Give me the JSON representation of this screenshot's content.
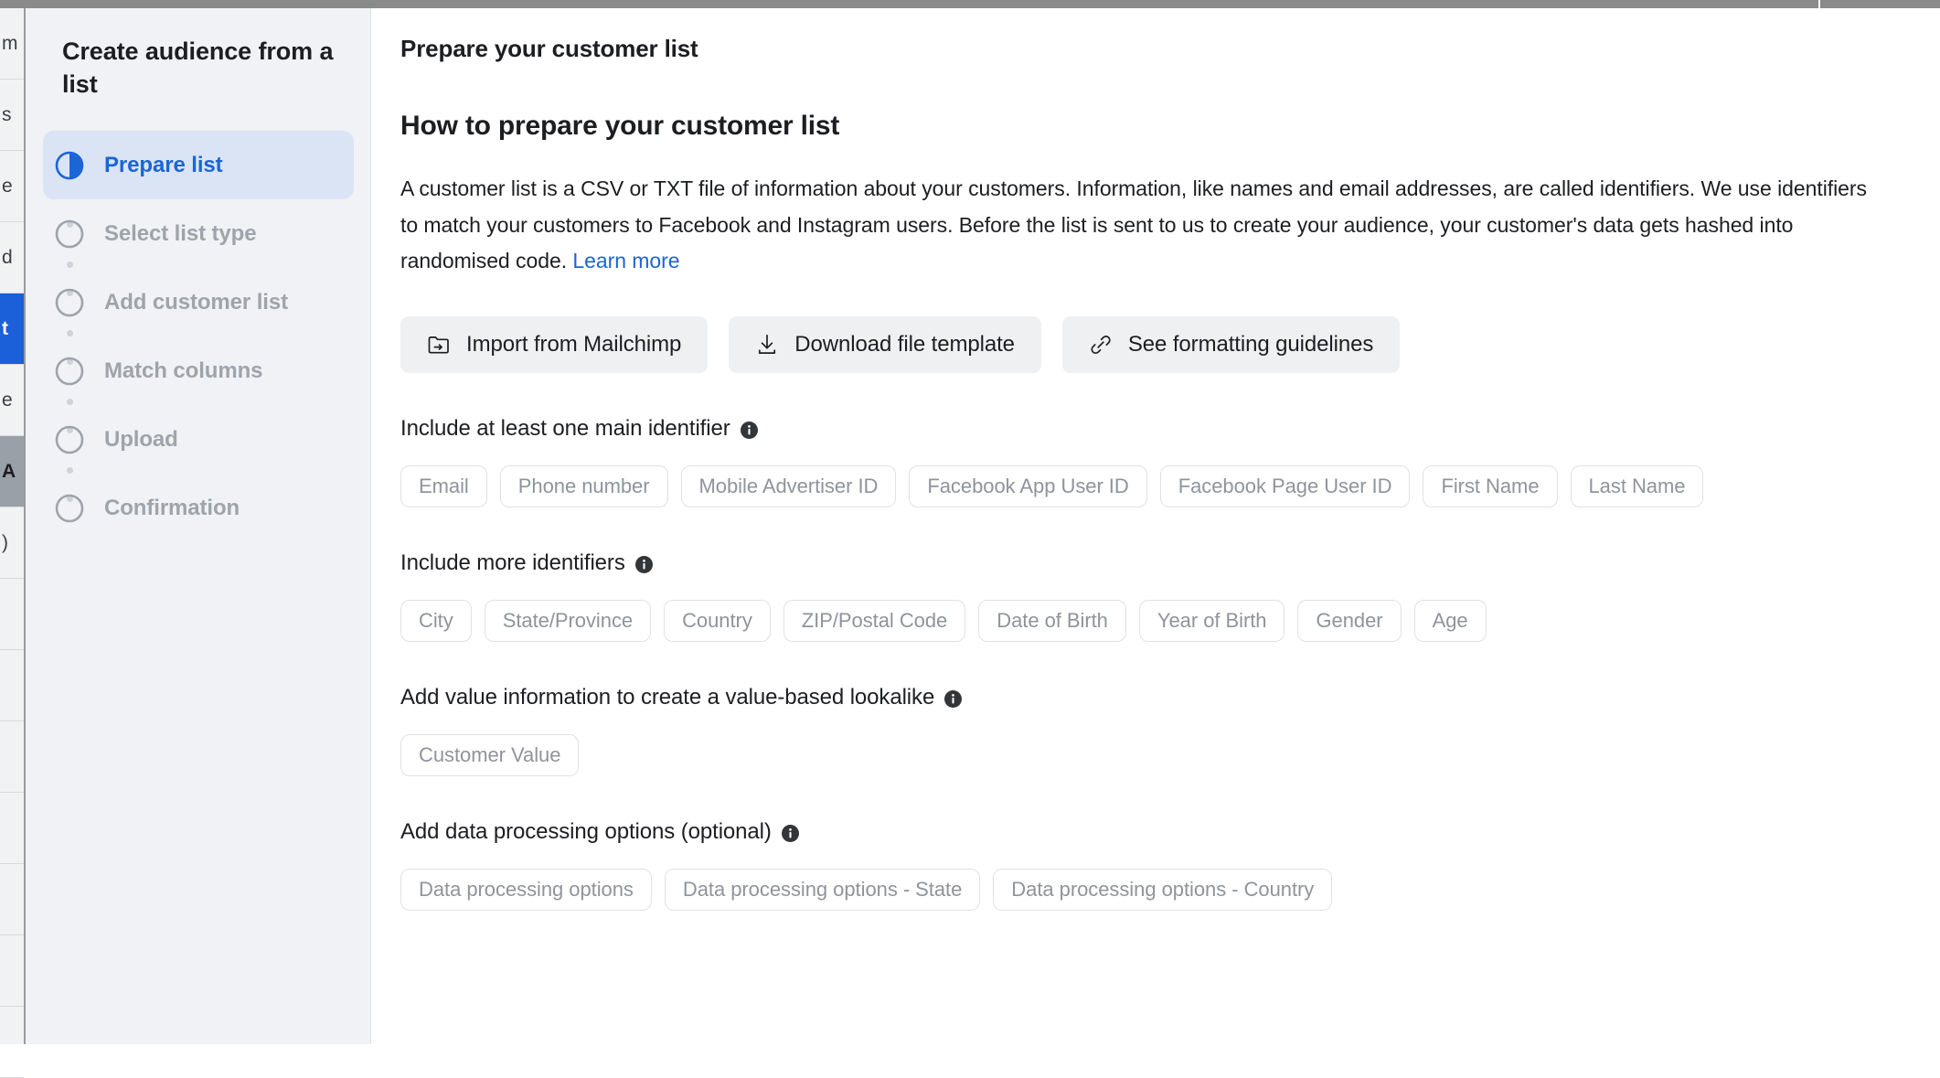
{
  "background": {
    "rows": [
      {
        "text": "m",
        "style": "normal"
      },
      {
        "text": "s",
        "style": "normal"
      },
      {
        "text": "e",
        "style": "normal"
      },
      {
        "text": "d",
        "style": "normal"
      },
      {
        "text": "t",
        "style": "selected"
      },
      {
        "text": "e",
        "style": "normal"
      },
      {
        "text": "A",
        "style": "header"
      },
      {
        "text": ")",
        "style": "normal"
      },
      {
        "text": "",
        "style": "normal"
      },
      {
        "text": "",
        "style": "normal"
      },
      {
        "text": "",
        "style": "normal"
      },
      {
        "text": "",
        "style": "normal"
      },
      {
        "text": "",
        "style": "normal"
      },
      {
        "text": "",
        "style": "normal"
      },
      {
        "text": "",
        "style": "normal"
      }
    ]
  },
  "dialog": {
    "title": "Create audience from a list"
  },
  "stepper": {
    "items": [
      {
        "label": "Prepare list",
        "state": "active",
        "icon": "half-filled-circle-icon"
      },
      {
        "label": "Select list type",
        "state": "pending",
        "icon": "empty-circle-icon"
      },
      {
        "label": "Add customer list",
        "state": "pending",
        "icon": "empty-circle-icon"
      },
      {
        "label": "Match columns",
        "state": "pending",
        "icon": "empty-circle-icon"
      },
      {
        "label": "Upload",
        "state": "pending",
        "icon": "empty-circle-icon"
      },
      {
        "label": "Confirmation",
        "state": "pending",
        "icon": "empty-circle-icon"
      }
    ]
  },
  "content": {
    "header_title": "Prepare your customer list",
    "section_title": "How to prepare your customer list",
    "intro_paragraph": {
      "text": "A customer list is a CSV or TXT file of information about your customers. Information, like names and email addresses, are called identifiers. We use identifiers to match your customers to Facebook and Instagram users. Before the list is sent to us to create your audience, your customer's data gets hashed into randomised code.",
      "link_label": "Learn more"
    },
    "actions": [
      {
        "label": "Import from Mailchimp",
        "icon": "folder-import-icon"
      },
      {
        "label": "Download file template",
        "icon": "download-icon"
      },
      {
        "label": "See formatting guidelines",
        "icon": "link-icon"
      }
    ],
    "sections": [
      {
        "heading": "Include at least one main identifier",
        "info_icon": "info-icon",
        "chips": [
          "Email",
          "Phone number",
          "Mobile Advertiser ID",
          "Facebook App User ID",
          "Facebook Page User ID",
          "First Name",
          "Last Name"
        ]
      },
      {
        "heading": "Include more identifiers",
        "info_icon": "info-icon",
        "chips": [
          "City",
          "State/Province",
          "Country",
          "ZIP/Postal Code",
          "Date of Birth",
          "Year of Birth",
          "Gender",
          "Age"
        ]
      },
      {
        "heading": "Add value information to create a value-based lookalike",
        "info_icon": "info-icon",
        "chips": [
          "Customer Value"
        ]
      },
      {
        "heading": "Add data processing options (optional)",
        "info_icon": "info-icon",
        "chips": [
          "Data processing options",
          "Data processing options - State",
          "Data processing options - Country"
        ]
      }
    ]
  },
  "colors": {
    "accent_blue": "#1b65d6",
    "active_step_pill": "#dbe4f5",
    "rail_background": "#f0f2f5",
    "button_background": "#eef0f2",
    "chip_border": "#dfe2e6",
    "chip_text": "#8f949b",
    "muted_step_text": "#9fa4ab",
    "primary_text": "#1c1e21"
  }
}
